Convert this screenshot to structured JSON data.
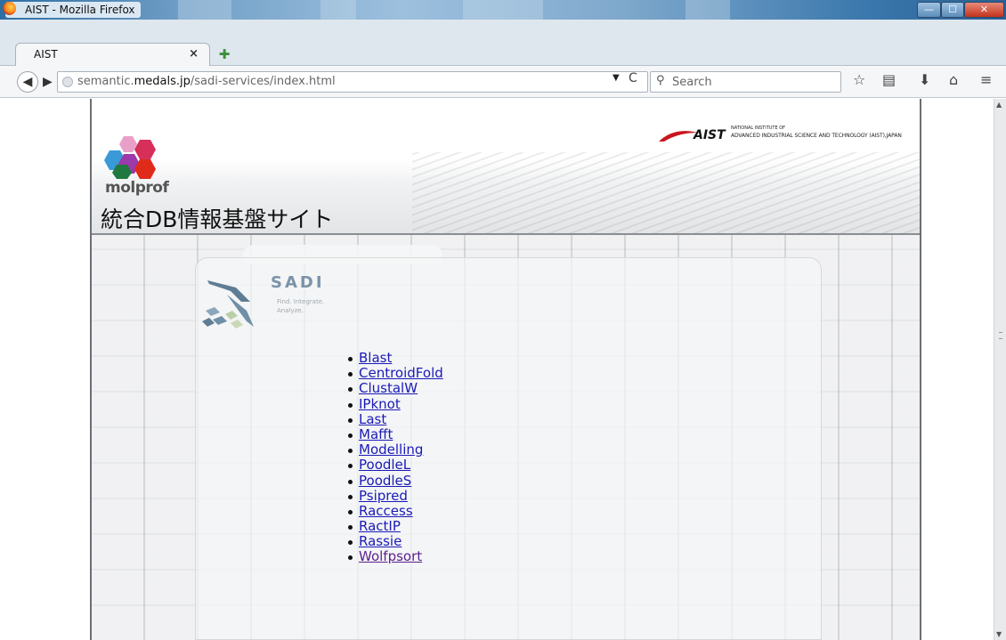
{
  "window": {
    "title": "AIST - Mozilla Firefox",
    "controls": {
      "minimize": "—",
      "maximize": "☐",
      "close": "✕"
    }
  },
  "tabs": [
    {
      "label": "AIST",
      "close_icon": "close-icon",
      "active": true
    }
  ],
  "new_tab_icon": "plus-icon",
  "navbar": {
    "back_icon": "back-arrow-icon",
    "forward_icon": "forward-arrow-icon",
    "url_prefix": "semantic.",
    "url_domain": "medals.jp",
    "url_path": "/sadi-services/index.html",
    "dropdown_icon": "▼",
    "reload_icon": "C",
    "search_placeholder": "Search",
    "icons": [
      "bookmark-star-icon",
      "reading-list-icon",
      "download-icon",
      "home-icon",
      "menu-icon"
    ]
  },
  "page": {
    "molprof": "molprof",
    "site_title": "統合DB情報基盤サイト",
    "aist_name": "AIST",
    "aist_small_line1": "NATIONAL INSTITUTE OF",
    "aist_full": "ADVANCED INDUSTRIAL SCIENCE AND TECHNOLOGY (AIST),JAPAN",
    "sadi_title": "SADI",
    "sadi_tag1": "Find. Integrate.",
    "sadi_tag2": "Analyze.",
    "services": [
      {
        "label": "Blast",
        "visited": false
      },
      {
        "label": "CentroidFold",
        "visited": false
      },
      {
        "label": "ClustalW",
        "visited": false
      },
      {
        "label": "IPknot",
        "visited": false
      },
      {
        "label": "Last",
        "visited": false
      },
      {
        "label": "Mafft",
        "visited": false
      },
      {
        "label": "Modelling",
        "visited": false
      },
      {
        "label": "PoodleL",
        "visited": false
      },
      {
        "label": "PoodleS",
        "visited": false
      },
      {
        "label": "Psipred",
        "visited": false
      },
      {
        "label": "Raccess",
        "visited": false
      },
      {
        "label": "RactIP",
        "visited": false
      },
      {
        "label": "Rassie",
        "visited": false
      },
      {
        "label": "Wolfpsort",
        "visited": true
      }
    ]
  },
  "colors": {
    "link": "#1a1ab8",
    "link_visited": "#5b1f8f",
    "aist_red": "#c8161d",
    "sadi_blue": "#7a93a8"
  }
}
